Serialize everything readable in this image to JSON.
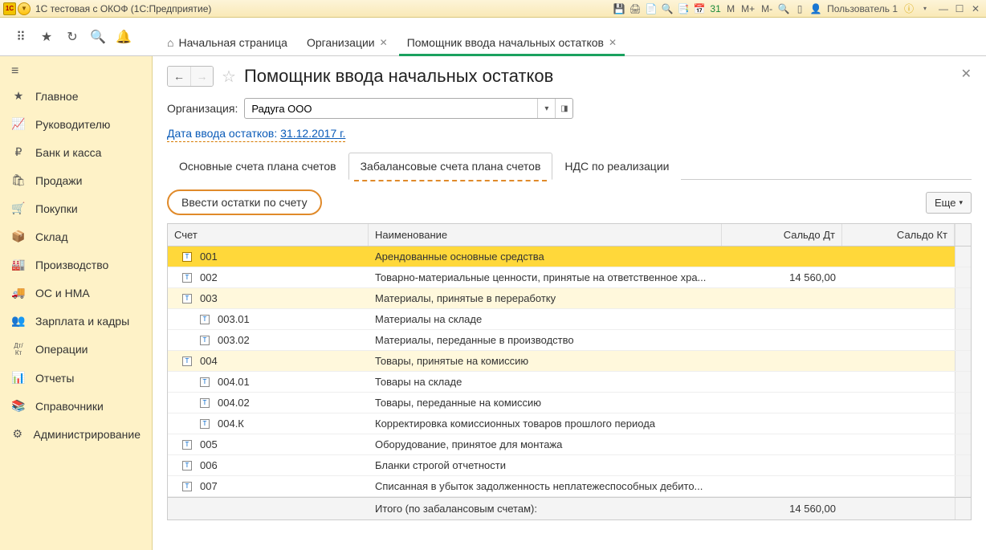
{
  "titlebar": {
    "logo_text": "1C",
    "title": "1С тестовая с ОКОФ  (1С:Предприятие)",
    "user_label": "Пользователь 1",
    "memory_labels": {
      "m": "M",
      "mplus": "M+",
      "mminus": "M-"
    }
  },
  "toolbar": {
    "tabs": [
      {
        "label": "Начальная страница",
        "home": true,
        "closable": false,
        "active": false
      },
      {
        "label": "Организации",
        "closable": true,
        "active": false
      },
      {
        "label": "Помощник ввода начальных остатков",
        "closable": true,
        "active": true
      }
    ]
  },
  "sidebar": {
    "items": [
      {
        "icon": "★",
        "label": "Главное"
      },
      {
        "icon": "📈",
        "label": "Руководителю"
      },
      {
        "icon": "₽",
        "label": "Банк и касса"
      },
      {
        "icon": "🛍",
        "label": "Продажи"
      },
      {
        "icon": "🛒",
        "label": "Покупки"
      },
      {
        "icon": "📦",
        "label": "Склад"
      },
      {
        "icon": "🏭",
        "label": "Производство"
      },
      {
        "icon": "🚚",
        "label": "ОС и НМА"
      },
      {
        "icon": "👥",
        "label": "Зарплата и кадры"
      },
      {
        "icon": "Дт/Кт",
        "label": "Операции"
      },
      {
        "icon": "📊",
        "label": "Отчеты"
      },
      {
        "icon": "📚",
        "label": "Справочники"
      },
      {
        "icon": "⚙",
        "label": "Администрирование"
      }
    ]
  },
  "page": {
    "title": "Помощник ввода начальных остатков",
    "org_label": "Организация:",
    "org_value": "Радуга ООО",
    "date_link_prefix": "Дата ввода остатков: ",
    "date_link_value": "31.12.2017 г.",
    "inner_tabs": [
      {
        "label": "Основные счета плана счетов",
        "active": false
      },
      {
        "label": "Забалансовые счета плана счетов",
        "active": true
      },
      {
        "label": "НДС по реализации",
        "active": false
      }
    ],
    "enter_button": "Ввести остатки по счету",
    "more_button": "Еще"
  },
  "table": {
    "headers": {
      "account": "Счет",
      "name": "Наименование",
      "debit": "Сальдо Дт",
      "credit": "Сальдо Кт"
    },
    "rows": [
      {
        "code": "001",
        "name": "Арендованные основные средства",
        "debit": "",
        "credit": "",
        "selected": true,
        "sub": false,
        "alt": false
      },
      {
        "code": "002",
        "name": "Товарно-материальные ценности, принятые на ответственное хра...",
        "debit": "14 560,00",
        "credit": "",
        "sub": false,
        "alt": false
      },
      {
        "code": "003",
        "name": "Материалы, принятые в переработку",
        "debit": "",
        "credit": "",
        "sub": false,
        "alt": true
      },
      {
        "code": "003.01",
        "name": "Материалы на складе",
        "debit": "",
        "credit": "",
        "sub": true,
        "alt": false
      },
      {
        "code": "003.02",
        "name": "Материалы, переданные в производство",
        "debit": "",
        "credit": "",
        "sub": true,
        "alt": false
      },
      {
        "code": "004",
        "name": "Товары, принятые на комиссию",
        "debit": "",
        "credit": "",
        "sub": false,
        "alt": true
      },
      {
        "code": "004.01",
        "name": "Товары на складе",
        "debit": "",
        "credit": "",
        "sub": true,
        "alt": false
      },
      {
        "code": "004.02",
        "name": "Товары, переданные на комиссию",
        "debit": "",
        "credit": "",
        "sub": true,
        "alt": false
      },
      {
        "code": "004.К",
        "name": "Корректировка комиссионных товаров прошлого периода",
        "debit": "",
        "credit": "",
        "sub": true,
        "alt": false
      },
      {
        "code": "005",
        "name": "Оборудование, принятое для монтажа",
        "debit": "",
        "credit": "",
        "sub": false,
        "alt": false
      },
      {
        "code": "006",
        "name": "Бланки строгой отчетности",
        "debit": "",
        "credit": "",
        "sub": false,
        "alt": false
      },
      {
        "code": "007",
        "name": "Списанная в убыток задолженность неплатежеспособных дебито...",
        "debit": "",
        "credit": "",
        "sub": false,
        "alt": false
      }
    ],
    "footer": {
      "label": "Итого (по забалансовым счетам):",
      "debit": "14 560,00",
      "credit": ""
    }
  }
}
